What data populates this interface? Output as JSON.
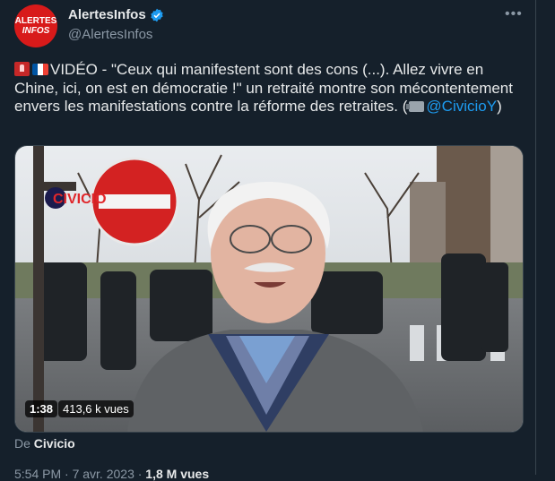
{
  "author": {
    "name": "AlertesInfos",
    "handle": "@AlertesInfos",
    "logo_line1": "ALERTES",
    "logo_line2": "INFOS"
  },
  "tweet": {
    "text_main": "VIDÉO - \"Ceux qui manifestent sont des cons (...). Allez vivre en Chine, ici, on est en démocratie !\" un retraité montre son mécontentement envers les manifestations contre la réforme des retraites. (",
    "mention": "@CivicioY",
    "text_end": ")",
    "emojis": [
      "rotating-light-icon",
      "france-flag-icon",
      "movie-camera-icon"
    ]
  },
  "media": {
    "watermark": "CIVICIO",
    "duration": "1:38",
    "views": "413,6 k vues"
  },
  "source": {
    "prefix": "De",
    "name": "Civicio"
  },
  "footer": {
    "time": "5:54 PM · 7 avr. 2023 · ",
    "views_label": "1,8 M vues"
  },
  "colors": {
    "background": "#15202b",
    "text": "#e7e9ea",
    "secondary": "#8b98a5",
    "accent": "#1d9bf0",
    "border": "#38444d"
  }
}
